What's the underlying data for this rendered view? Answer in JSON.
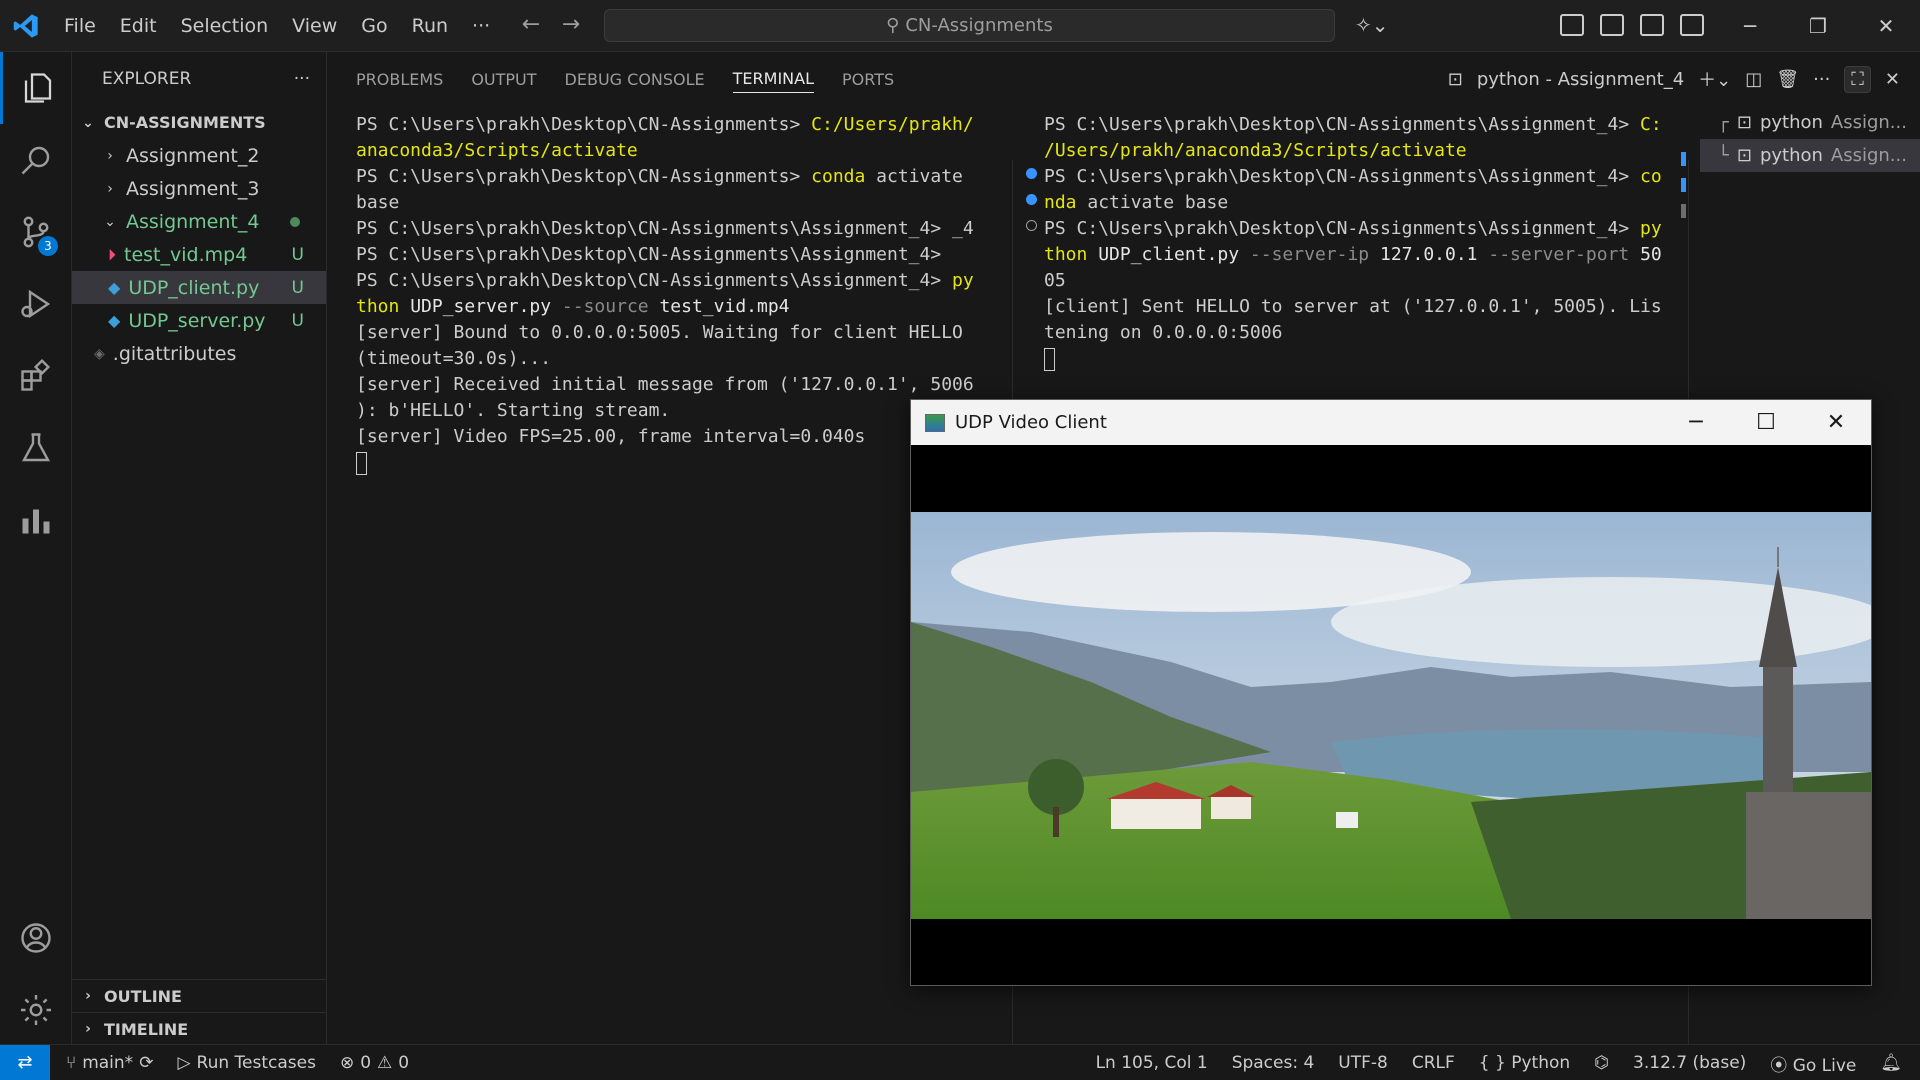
{
  "menu": [
    "File",
    "Edit",
    "Selection",
    "View",
    "Go",
    "Run",
    "···"
  ],
  "search": {
    "text": "CN-Assignments"
  },
  "sidebar": {
    "title": "EXPLORER",
    "more": "···",
    "root": "CN-ASSIGNMENTS",
    "items": [
      {
        "label": "Assignment_2"
      },
      {
        "label": "Assignment_3"
      },
      {
        "label": "Assignment_4"
      },
      {
        "label": "test_vid.mp4",
        "status": "U"
      },
      {
        "label": "UDP_client.py",
        "status": "U"
      },
      {
        "label": "UDP_server.py",
        "status": "U"
      },
      {
        "label": ".gitattributes"
      }
    ],
    "outline": "OUTLINE",
    "timeline": "TIMELINE",
    "scm_badge": "3"
  },
  "panel": {
    "tabs": [
      "PROBLEMS",
      "OUTPUT",
      "DEBUG CONSOLE",
      "TERMINAL",
      "PORTS"
    ],
    "terminal_title": "python - Assignment_4"
  },
  "terminal_left": {
    "l1_prompt": "PS C:\\Users\\prakh\\Desktop\\CN-Assignments> ",
    "l1_cmd": "C:/Users/prakh/",
    "l2_cmd": "anaconda3/Scripts/activate",
    "l3_prompt": "PS C:\\Users\\prakh\\Desktop\\CN-Assignments> ",
    "l3_cmd": "conda",
    "l3_arg": " activate",
    "l4": "base",
    "l5": "PS C:\\Users\\prakh\\Desktop\\CN-Assignments\\Assignment_4> _4",
    "l6": "PS C:\\Users\\prakh\\Desktop\\CN-Assignments\\Assignment_4>",
    "l7_prompt": "PS C:\\Users\\prakh\\Desktop\\CN-Assignments\\Assignment_4> ",
    "l7_cmd": "py",
    "l8_cmd": "thon",
    "l8_file": " UDP_server.py ",
    "l8_flag": "--source",
    "l8_val": " test_vid.mp4",
    "l9": "[server] Bound to 0.0.0.0:5005. Waiting for client HELLO",
    "l10": "(timeout=30.0s)...",
    "l11": "[server] Received initial message from ('127.0.0.1', 5006",
    "l12": "): b'HELLO'. Starting stream.",
    "l13": "[server] Video FPS=25.00, frame interval=0.040s"
  },
  "terminal_right": {
    "l1_prompt": "PS C:\\Users\\prakh\\Desktop\\CN-Assignments\\Assignment_4> ",
    "l1_cmd": "C:",
    "l2_cmd": "/Users/prakh/anaconda3/Scripts/activate",
    "l3_prompt": "PS C:\\Users\\prakh\\Desktop\\CN-Assignments\\Assignment_4> ",
    "l3_cmd": "co",
    "l4_cmd": "nda",
    "l4_rest": " activate base",
    "l5_prompt": "PS C:\\Users\\prakh\\Desktop\\CN-Assignments\\Assignment_4> ",
    "l5_cmd": "py",
    "l6_cmd": "thon",
    "l6_file": " UDP_client.py ",
    "l6_flag1": "--server-ip",
    "l6_val1": " 127.0.0.1 ",
    "l6_flag2": "--server-port",
    "l6_val2": " 50",
    "l7": "05",
    "l8": "[client] Sent HELLO to server at ('127.0.0.1', 5005). Lis",
    "l9": "tening on 0.0.0.0:5006"
  },
  "terminal_list": [
    {
      "name": "python",
      "folder": "Assign..."
    },
    {
      "name": "python",
      "folder": "Assign..."
    }
  ],
  "udp_window": {
    "title": "UDP Video Client"
  },
  "statusbar": {
    "branch": "main*",
    "run": "Run Testcases",
    "errors": "0",
    "warnings": "0",
    "position": "Ln 105, Col 1",
    "spaces": "Spaces: 4",
    "encoding": "UTF-8",
    "eol": "CRLF",
    "language": "Python",
    "interpreter": "3.12.7 (base)",
    "golive": "Go Live"
  },
  "colors": {
    "accent": "#0078d4",
    "untracked": "#73c991",
    "cmd_yellow": "#e5e510"
  }
}
